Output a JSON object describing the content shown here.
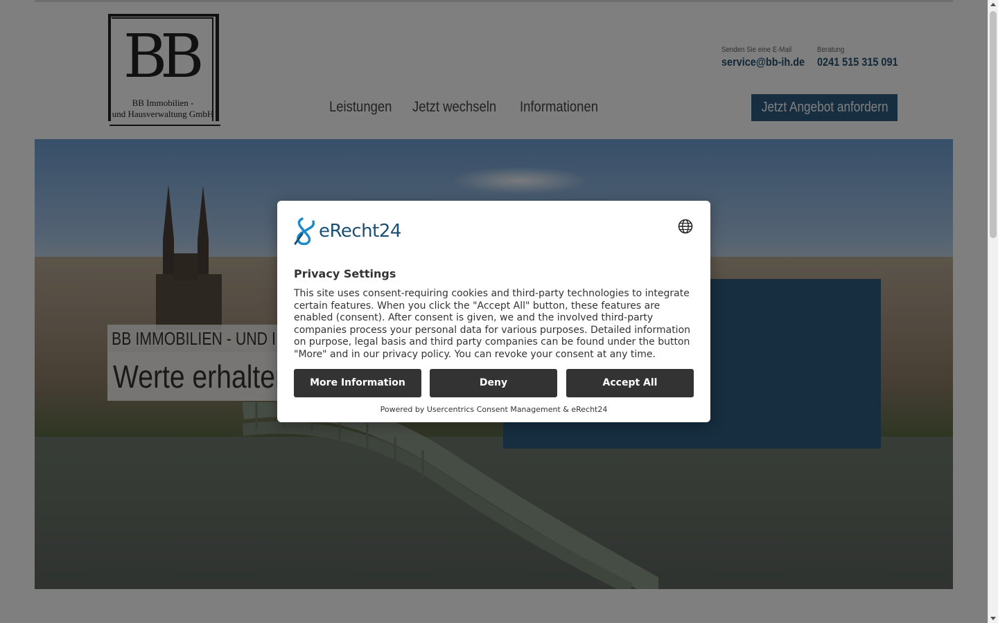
{
  "header": {
    "logo_initials": "BB",
    "logo_line1": "BB Immobilien -",
    "logo_line2": "und Hausverwaltung GmbH",
    "email_label": "Senden Sie eine E-Mail",
    "email_value": "service@bb-ih.de",
    "phone_label": "Beratung",
    "phone_value": "0241 515 315 091"
  },
  "nav": {
    "items": [
      {
        "label": "Leistungen"
      },
      {
        "label": "Jetzt wechseln"
      },
      {
        "label": "Informationen"
      }
    ],
    "cta_label": "Jetzt Angebot anfordern"
  },
  "hero": {
    "tagline": "BB IMMOBILIEN - UND I",
    "title": "Werte erhalten"
  },
  "consent": {
    "brand": "eRecht24",
    "title": "Privacy Settings",
    "body": "This site uses consent-requiring cookies and third-party technologies to integrate certain features. When you click the \"Accept All\" button, these features are enabled (consent). After consent is given, we and the involved third-party companies process your personal data for various purposes. Detailed information on purpose, legal basis and third party companies can be found under the button \"More\" and in our privacy policy. You can revoke your consent at any time.",
    "more_label": "More Information",
    "deny_label": "Deny",
    "accept_label": "Accept All",
    "powered_by": "Powered by Usercentrics Consent Management & eRecht24",
    "language_icon": "globe-icon"
  },
  "colors": {
    "brand_blue": "#2d5d80",
    "link_blue": "#24506e",
    "button_dark": "#333333"
  }
}
